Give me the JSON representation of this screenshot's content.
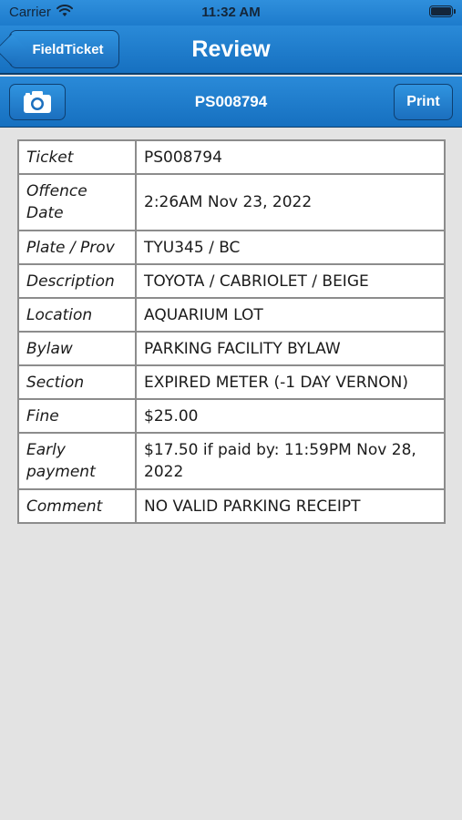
{
  "status_bar": {
    "carrier": "Carrier",
    "time": "11:32 AM"
  },
  "nav": {
    "back_label": "FieldTicket",
    "title": "Review"
  },
  "toolbar": {
    "ticket_number": "PS008794",
    "print_label": "Print",
    "camera_icon": "camera-icon"
  },
  "ticket": {
    "rows": [
      {
        "label": "Ticket",
        "value": "PS008794"
      },
      {
        "label": "Offence Date",
        "value": "2:26AM Nov 23, 2022"
      },
      {
        "label": "Plate / Prov",
        "value": "TYU345 / BC"
      },
      {
        "label": "Description",
        "value": "TOYOTA / CABRIOLET / BEIGE"
      },
      {
        "label": "Location",
        "value": "AQUARIUM LOT"
      },
      {
        "label": "Bylaw",
        "value": "PARKING FACILITY BYLAW"
      },
      {
        "label": "Section",
        "value": "EXPIRED METER (-1 DAY VERNON)"
      },
      {
        "label": "Fine",
        "value": "$25.00"
      },
      {
        "label": "Early payment",
        "value": "$17.50 if paid by: 11:59PM Nov 28, 2022"
      },
      {
        "label": "Comment",
        "value": "NO VALID PARKING RECEIPT"
      }
    ]
  },
  "colors": {
    "bar_blue": "#1d7bcc",
    "bar_border": "#0d3e6b",
    "background": "#e3e3e3",
    "table_border": "#8c8c8c"
  }
}
